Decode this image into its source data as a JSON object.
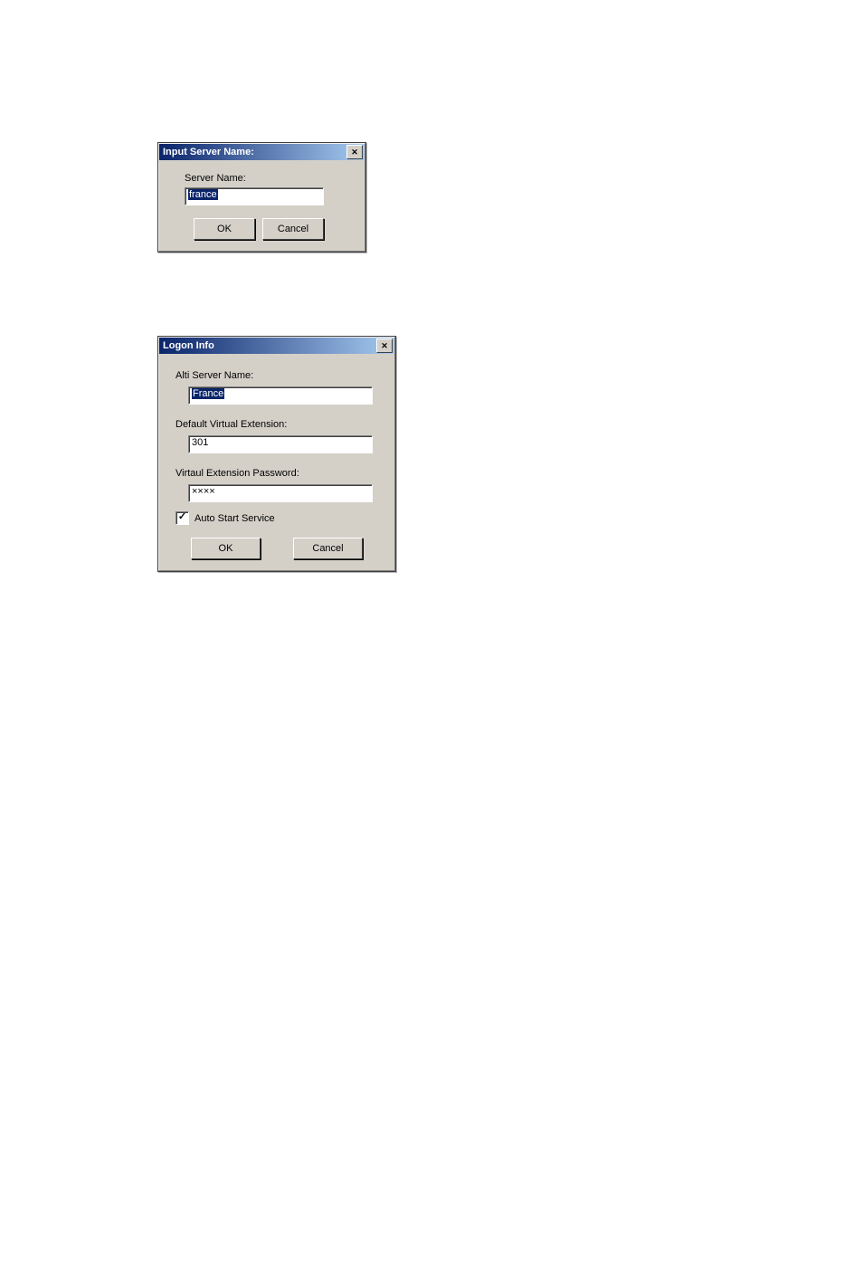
{
  "dialog1": {
    "title": "Input Server Name:",
    "server_name_label": "Server Name:",
    "server_name_value": "france",
    "ok_label": "OK",
    "cancel_label": "Cancel"
  },
  "dialog2": {
    "title": "Logon Info",
    "alti_server_label": "Alti Server Name:",
    "alti_server_value": "France",
    "default_ext_label": "Default Virtual Extension:",
    "default_ext_value": "301",
    "password_label": "Virtaul Extension Password:",
    "password_value": "××××",
    "auto_start_label": "Auto Start Service",
    "auto_start_checked": true,
    "ok_label": "OK",
    "cancel_label": "Cancel"
  }
}
